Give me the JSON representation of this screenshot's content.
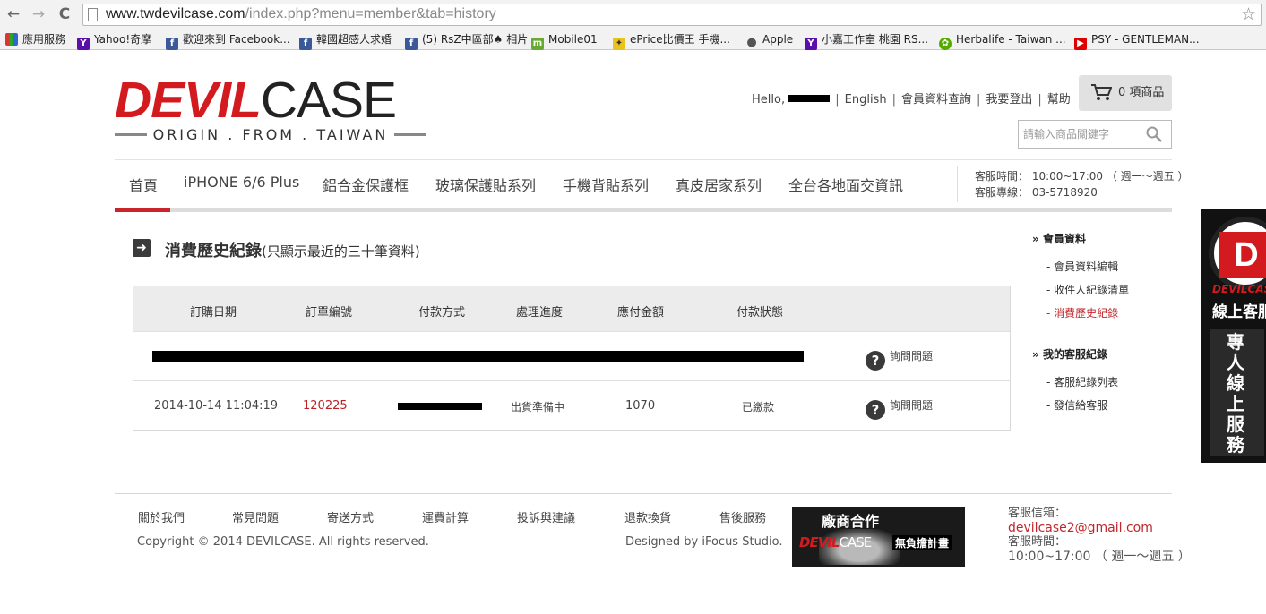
{
  "browser": {
    "back_icon": "←",
    "forward_icon": "→",
    "reload_icon": "C",
    "url_host": "www.twdevilcase.com",
    "url_path": "/index.php?menu=member&tab=history",
    "star_icon": "☆",
    "bookmarks": [
      {
        "label": "應用服務",
        "icon": "apps-icon"
      },
      {
        "label": "Yahoo!奇摩",
        "icon": "yahoo-icon"
      },
      {
        "label": "歡迎來到 Facebook...",
        "icon": "facebook-icon"
      },
      {
        "label": "韓國超感人求婚",
        "icon": "facebook-icon"
      },
      {
        "label": "(5) RsZ中區部♠ 相片",
        "icon": "facebook-icon"
      },
      {
        "label": "Mobile01",
        "icon": "mobile01-icon"
      },
      {
        "label": "ePrice比價王 手機...",
        "icon": "eprice-icon"
      },
      {
        "label": "Apple",
        "icon": "apple-icon"
      },
      {
        "label": "小嘉工作室 桃園 RS...",
        "icon": "yahoo-icon"
      },
      {
        "label": "Herbalife - Taiwan ...",
        "icon": "herbalife-icon"
      },
      {
        "label": "PSY - GENTLEMAN...",
        "icon": "youtube-icon"
      }
    ]
  },
  "header": {
    "logo_red": "DEVIL",
    "logo_black": "CASE",
    "logo_tagline": "ORIGIN . FROM . TAIWAN",
    "hello": "Hello,",
    "links": [
      "English",
      "會員資料查詢",
      "我要登出",
      "幫助"
    ],
    "separator": "|",
    "cart_label": "0 項商品",
    "search_placeholder": "請輸入商品關鍵字"
  },
  "nav": {
    "items": [
      "首頁",
      "iPHONE 6/6 Plus",
      "鋁合金保護框",
      "玻璃保護貼系列",
      "手機背貼系列",
      "真皮居家系列",
      "全台各地面交資訊"
    ],
    "active_index": 0,
    "service_hours": "客服時間： 10:00~17:00 （ 週一～週五 ）",
    "service_phone": "客服專線： 03-5718920"
  },
  "content": {
    "title": "消費歷史紀錄",
    "subtitle": "(只顯示最近的三十筆資料)",
    "columns": [
      "訂購日期",
      "訂單編號",
      "付款方式",
      "處理進度",
      "應付金額",
      "付款狀態"
    ],
    "rows": [
      {
        "date": "",
        "order_no": "",
        "payment": "",
        "progress": "",
        "amount": "",
        "status": "",
        "ask": "詢問問題"
      },
      {
        "date": "2014-10-14 11:04:19",
        "order_no": "120225",
        "payment": "",
        "progress": "出貨準備中",
        "amount": "1070",
        "status": "已繳款",
        "ask": "詢問問題"
      }
    ]
  },
  "sidebar": {
    "groups": [
      {
        "title": "會員資料",
        "items": [
          "- 會員資料編輯",
          "- 收件人紀錄清單",
          "- 消費歷史紀錄"
        ],
        "active": 2
      },
      {
        "title": "我的客服紀錄",
        "items": [
          "- 客服紀錄列表",
          "- 發信給客服"
        ],
        "active": -1
      }
    ]
  },
  "float_banner": {
    "brand_small": "DEVILCASE",
    "title": "線上客服",
    "vertical": "專人線上服務"
  },
  "footer": {
    "links": [
      "關於我們",
      "常見問題",
      "寄送方式",
      "運費計算",
      "投訴與建議",
      "退款換貨",
      "售後服務"
    ],
    "copyright": "Copyright © 2014 DEVILCASE. All rights reserved.",
    "designed_by": "Designed by iFocus Studio.",
    "coop_title": "廠商合作",
    "coop_brand_red": "DEVIL",
    "coop_brand_white": "CASE",
    "coop_plan": "無負擔計畫",
    "email_label": "客服信箱：",
    "email": "devilcase2@gmail.com",
    "hours_label": "客服時間：",
    "hours": "10:00~17:00 （ 週一～週五 ）"
  },
  "colors": {
    "brand_red": "#d21a1f",
    "active_link": "#c0262b"
  }
}
